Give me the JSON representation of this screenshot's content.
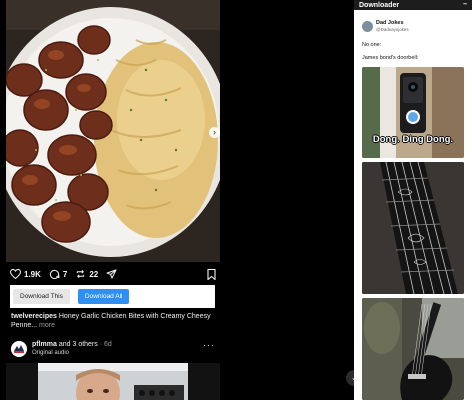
{
  "post": {
    "image_alt": "Honey garlic chicken bites with creamy cheesy penne",
    "likes": "1.9K",
    "comments": "7",
    "reposts": "22",
    "icons": [
      "heart-icon",
      "comment-icon",
      "repost-icon",
      "share-icon",
      "bookmark-icon",
      "chevron-right-icon"
    ],
    "download_this_label": "Download This",
    "download_all_label": "Download All",
    "accent_color": "#2f8ff2",
    "caption_user": "twelverecipes",
    "caption_text": " Honey Garlic Chicken Bites with Creamy Cheesy Penne...",
    "caption_more": " more"
  },
  "next_post": {
    "author": "pflmma",
    "others": " and 3 others",
    "time": " · 6d",
    "audio": "Original audio",
    "more_label": "···"
  },
  "panel": {
    "title": "Downloader",
    "minimize": "–",
    "tweet": {
      "name": "Dad Jokes",
      "handle": "@Dadsaysjokes",
      "line1": "No one:",
      "line2": "James bond's doorbell:",
      "media_caption": "Dong. Ding Dong."
    }
  },
  "scroll_button_label": "⌄"
}
